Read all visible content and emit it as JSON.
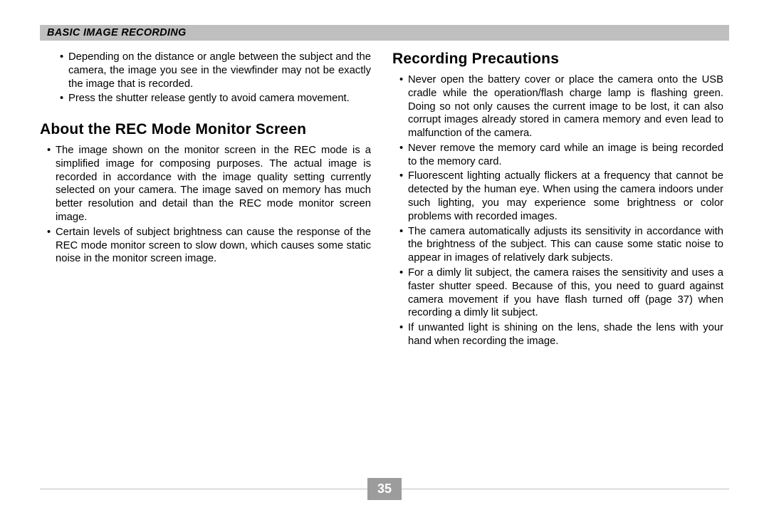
{
  "header": {
    "title": "BASIC IMAGE RECORDING"
  },
  "left": {
    "top_bullets": [
      "Depending on the distance or angle between the subject and the camera, the image you see in the viewfinder may not be exactly the image that is recorded.",
      "Press the shutter release gently to avoid camera movement."
    ],
    "heading": "About the REC Mode Monitor Screen",
    "bullets": [
      "The image shown on the monitor screen in the REC mode is a simplified image for composing purposes.  The actual image is recorded in accordance with the image quality setting currently selected on your camera.  The image saved on memory has much better resolution and detail than the REC mode monitor screen image.",
      "Certain levels of subject brightness can cause the response of the REC mode monitor screen to slow down, which causes some static noise in the monitor screen image."
    ]
  },
  "right": {
    "heading": "Recording Precautions",
    "bullets": [
      "Never open the battery cover or place the camera onto the USB cradle while the operation/flash charge lamp is flashing green. Doing so not only causes the current image to be lost, it can also corrupt images already stored in camera memory and even lead to malfunction of the camera.",
      "Never remove the memory card while an image is being recorded to the memory card.",
      "Fluorescent lighting actually flickers at a frequency that cannot be detected by the human eye.  When using the camera indoors under such lighting, you may experience some brightness or color problems with recorded images.",
      "The camera automatically adjusts its sensitivity in accordance with the brightness of the subject. This can cause some static noise to appear in images of relatively dark subjects.",
      "For a dimly lit subject, the camera raises the sensitivity and uses a faster shutter speed. Because of this, you need to guard against camera movement if you have flash turned off (page 37) when recording a dimly lit subject.",
      "If unwanted light is shining on the lens, shade the lens with your hand when recording the image."
    ]
  },
  "page_number": "35"
}
